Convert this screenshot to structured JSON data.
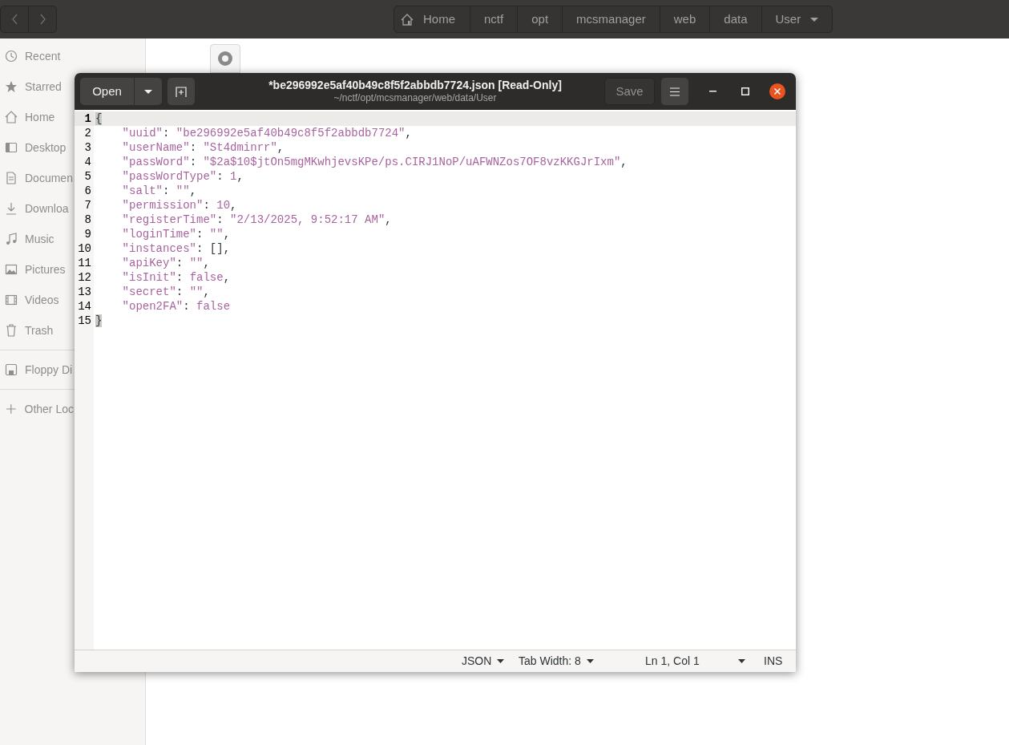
{
  "file_manager": {
    "path": [
      {
        "label": "Home",
        "kind": "home"
      },
      {
        "label": "nctf",
        "kind": "folder"
      },
      {
        "label": "opt",
        "kind": "folder"
      },
      {
        "label": "mcsmanager",
        "kind": "folder"
      },
      {
        "label": "web",
        "kind": "folder"
      },
      {
        "label": "data",
        "kind": "folder"
      },
      {
        "label": "User",
        "kind": "current"
      }
    ],
    "sidebar": [
      {
        "label": "Recent",
        "kind": "place"
      },
      {
        "label": "Starred",
        "kind": "place"
      },
      {
        "label": "Home",
        "kind": "place"
      },
      {
        "label": "Desktop",
        "kind": "place"
      },
      {
        "label": "Documen",
        "kind": "place"
      },
      {
        "label": "Downloa",
        "kind": "place"
      },
      {
        "label": "Music",
        "kind": "place"
      },
      {
        "label": "Pictures",
        "kind": "place"
      },
      {
        "label": "Videos",
        "kind": "place"
      },
      {
        "label": "Trash",
        "kind": "place"
      },
      {
        "label": "Floppy Di",
        "kind": "device"
      },
      {
        "label": "Other Loc",
        "kind": "other"
      }
    ]
  },
  "editor": {
    "title": "*be296992e5af40b49c8f5f2abbdb7724.json [Read-Only]",
    "subtitle": "~/nctf/opt/mcsmanager/web/data/User",
    "open_button": "Open",
    "save_button": "Save",
    "lines": [
      {
        "number": "1",
        "text": "{",
        "current": true,
        "matched": true
      },
      {
        "number": "2",
        "text": "    \"uuid\": \"be296992e5af40b49c8f5f2abbdb7724\",",
        "current": false
      },
      {
        "number": "3",
        "text": "    \"userName\": \"St4dminrr\",",
        "current": false
      },
      {
        "number": "4",
        "text": "    \"passWord\": \"$2a$10$jtOn5mgMKwhjevsKPe/ps.CIRJ1NoP/uAFWNZos7OF8vzKKGJrIxm\",",
        "current": false
      },
      {
        "number": "5",
        "text": "    \"passWordType\": 1,",
        "current": false
      },
      {
        "number": "6",
        "text": "    \"salt\": \"\",",
        "current": false
      },
      {
        "number": "7",
        "text": "    \"permission\": 10,",
        "current": false
      },
      {
        "number": "8",
        "text": "    \"registerTime\": \"2/13/2025, 9:52:17 AM\",",
        "current": false
      },
      {
        "number": "9",
        "text": "    \"loginTime\": \"\",",
        "current": false
      },
      {
        "number": "10",
        "text": "    \"instances\": [],",
        "current": false
      },
      {
        "number": "11",
        "text": "    \"apiKey\": \"\",",
        "current": false
      },
      {
        "number": "12",
        "text": "    \"isInit\": false,",
        "current": false
      },
      {
        "number": "13",
        "text": "    \"secret\": \"\",",
        "current": false
      },
      {
        "number": "14",
        "text": "    \"open2FA\": false",
        "current": false
      },
      {
        "number": "15",
        "text": "}",
        "current": false,
        "matched": true
      }
    ],
    "status_bar": {
      "language": "JSON",
      "tab_width": "Tab Width: 8",
      "position": "Ln 1, Col 1",
      "mode": "INS"
    }
  }
}
